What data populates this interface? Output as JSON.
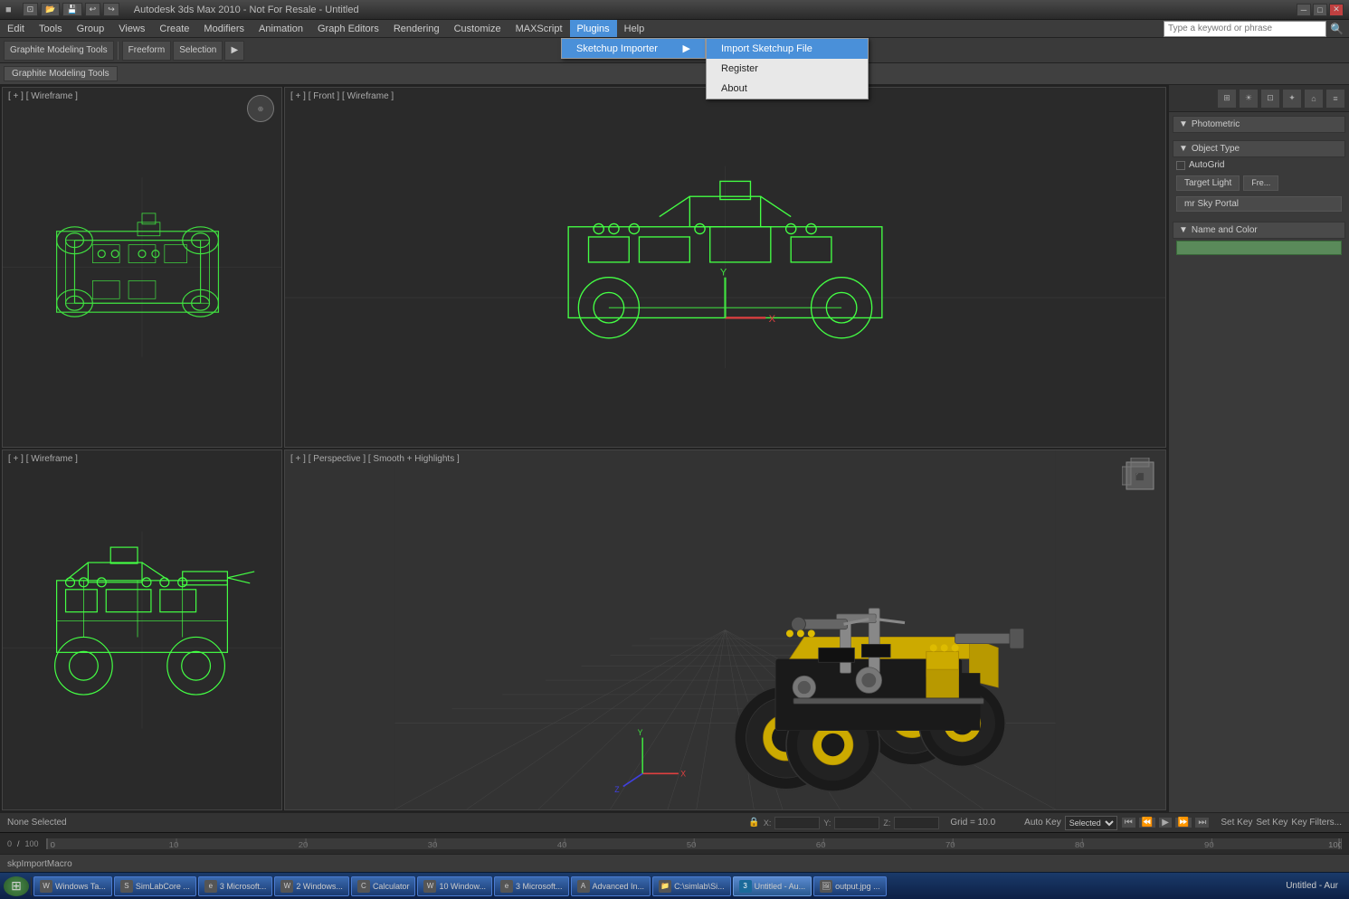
{
  "title_bar": {
    "title": "Autodesk 3ds Max 2010 - Not For Resale - Untitled",
    "quick_access": [
      "new",
      "open",
      "save",
      "undo",
      "redo"
    ],
    "window_controls": [
      "minimize",
      "maximize",
      "close"
    ]
  },
  "menu_bar": {
    "items": [
      {
        "label": "Edit",
        "active": false
      },
      {
        "label": "Tools",
        "active": false
      },
      {
        "label": "Group",
        "active": false
      },
      {
        "label": "Views",
        "active": false
      },
      {
        "label": "Create",
        "active": false
      },
      {
        "label": "Modifiers",
        "active": false
      },
      {
        "label": "Animation",
        "active": false
      },
      {
        "label": "Graph Editors",
        "active": false
      },
      {
        "label": "Rendering",
        "active": false
      },
      {
        "label": "Customize",
        "active": false
      },
      {
        "label": "MAXScript",
        "active": false
      },
      {
        "label": "Plugins",
        "active": true
      },
      {
        "label": "Help",
        "active": false
      }
    ],
    "search_placeholder": "Type a keyword or phrase"
  },
  "plugins_dropdown": {
    "items": [
      {
        "label": "Sketchup Importer",
        "has_submenu": true
      }
    ]
  },
  "plugins_submenu": {
    "items": [
      {
        "label": "Import Sketchup File",
        "highlighted": true
      },
      {
        "label": "Register"
      },
      {
        "label": "About"
      }
    ]
  },
  "toolbar": {
    "items": [
      "Graphite Modeling Tools",
      "Freeform",
      "Selection"
    ]
  },
  "modeling_tabs": {
    "items": [
      "Graphite Modeling Tools",
      "Freeform",
      "Selection"
    ]
  },
  "viewports": {
    "top_left": {
      "label": "[ + ] [ Wireframe ]",
      "type": "wireframe",
      "view": "Top"
    },
    "top_right": {
      "label": "[ + ] [ Front ] [ Wireframe ]",
      "type": "wireframe",
      "view": "Front"
    },
    "bottom_left": {
      "label": "[ + ] [ Wireframe ]",
      "type": "wireframe",
      "view": "Left"
    },
    "bottom_right": {
      "label": "[ + ] [ Perspective ] [ Smooth + Highlights ]",
      "type": "shaded",
      "view": "Perspective"
    }
  },
  "right_panel": {
    "toolbar_icons": [
      "camera",
      "light",
      "grid",
      "helper",
      "shape",
      "settings"
    ],
    "sections": [
      {
        "title": "Photometric",
        "collapsed": false
      },
      {
        "title": "Object Type",
        "items": [
          {
            "type": "checkbox",
            "label": "AutoGrid"
          },
          {
            "type": "button",
            "label": "Target Light"
          },
          {
            "type": "button",
            "label": "Free Light"
          },
          {
            "type": "button",
            "label": "mr Sky Portal"
          }
        ]
      },
      {
        "title": "Name and Color",
        "color": "#5a8a5a"
      }
    ]
  },
  "status_bar": {
    "selection": "None Selected",
    "x_label": "X:",
    "x_value": "",
    "y_label": "Y:",
    "y_value": "",
    "z_label": "Z:",
    "z_value": "",
    "grid_label": "Grid = 10.0",
    "auto_key_label": "Auto Key",
    "set_key_label": "Set Key",
    "key_filters_label": "Key Filters..."
  },
  "timeline": {
    "start": "0",
    "end": "100",
    "current": "0"
  },
  "macro_bar": {
    "label": "skpImportMacro"
  },
  "taskbar": {
    "items": [
      {
        "label": "Windows Ta...",
        "active": false,
        "icon": "win"
      },
      {
        "label": "SimLabCore ...",
        "active": false,
        "icon": "sim"
      },
      {
        "label": "3 Microsoft...",
        "active": false,
        "icon": "ie"
      },
      {
        "label": "2 Windows...",
        "active": false,
        "icon": "win"
      },
      {
        "label": "Calculator",
        "active": false,
        "icon": "calc"
      },
      {
        "label": "10 Window...",
        "active": false,
        "icon": "win"
      },
      {
        "label": "3 Microsoft...",
        "active": false,
        "icon": "ie"
      },
      {
        "label": "Advanced In...",
        "active": false,
        "icon": "adv"
      },
      {
        "label": "C:\\simlab\\Si...",
        "active": false,
        "icon": "folder"
      },
      {
        "label": "Untitled - Au...",
        "active": true,
        "icon": "3ds"
      },
      {
        "label": "output.jpg ...",
        "active": false,
        "icon": "img"
      }
    ],
    "time": "Untitled - Aur"
  }
}
